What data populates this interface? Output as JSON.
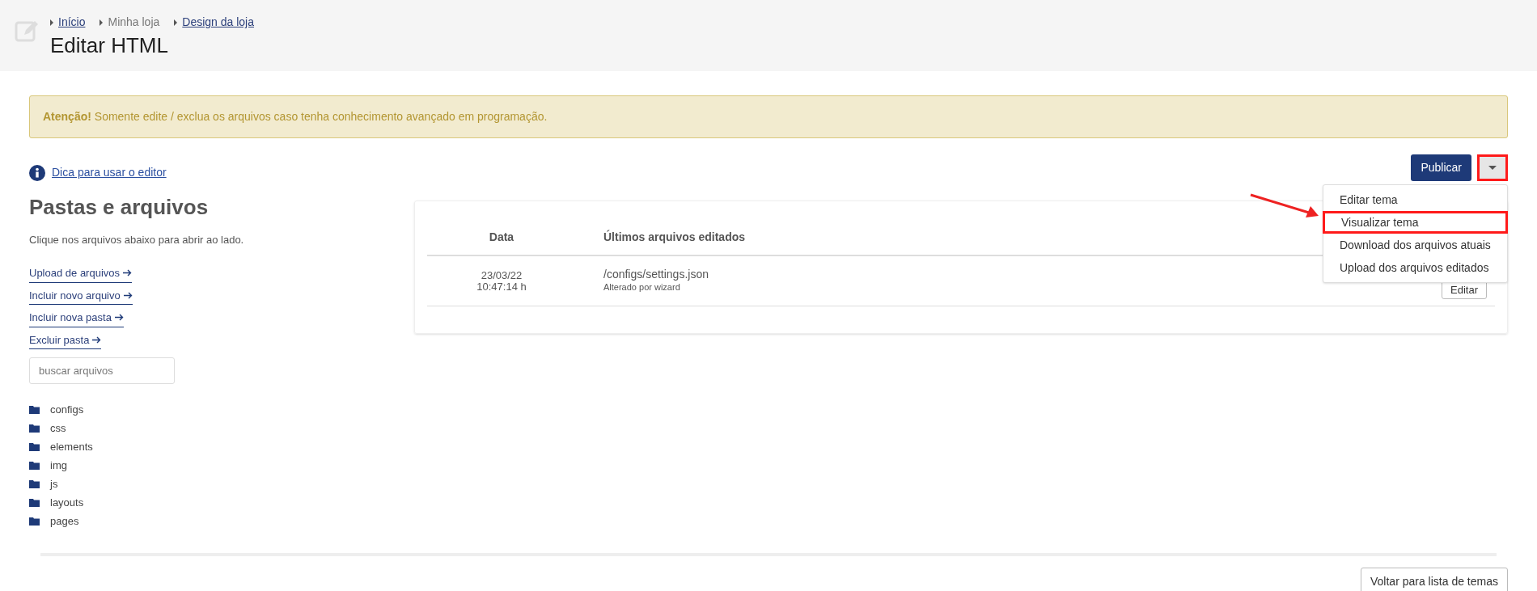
{
  "breadcrumbs": [
    {
      "label": "Início",
      "link": true
    },
    {
      "label": "Minha loja",
      "link": false
    },
    {
      "label": "Design da loja",
      "link": true
    }
  ],
  "title": "Editar HTML",
  "alert": {
    "strong": "Atenção!",
    "text": "Somente edite / exclua os arquivos caso tenha conhecimento avançado em programação."
  },
  "tip_link": "Dica para usar o editor",
  "publish_button": "Publicar",
  "dropdown": {
    "annotated": true,
    "items": [
      {
        "label": "Editar tema",
        "annotated": false
      },
      {
        "label": "Visualizar tema",
        "annotated": true
      },
      {
        "label": "Download dos arquivos atuais",
        "annotated": false
      },
      {
        "label": "Upload dos arquivos editados",
        "annotated": false
      }
    ]
  },
  "sidebar": {
    "heading": "Pastas e arquivos",
    "hint": "Clique nos arquivos abaixo para abrir ao lado.",
    "actions": [
      "Upload de arquivos",
      "Incluir novo arquivo",
      "Incluir nova pasta",
      "Excluir pasta"
    ],
    "search": {
      "placeholder": "buscar arquivos"
    },
    "folders": [
      "configs",
      "css",
      "elements",
      "img",
      "js",
      "layouts",
      "pages"
    ]
  },
  "table": {
    "columns": [
      "Data",
      "Últimos arquivos editados"
    ],
    "rows": [
      {
        "date": "23/03/22",
        "time": "10:47:14 h",
        "file": "/configs/settings.json",
        "note": "Alterado por wizard",
        "action": "Editar"
      }
    ]
  },
  "back_button": "Voltar para lista de temas"
}
